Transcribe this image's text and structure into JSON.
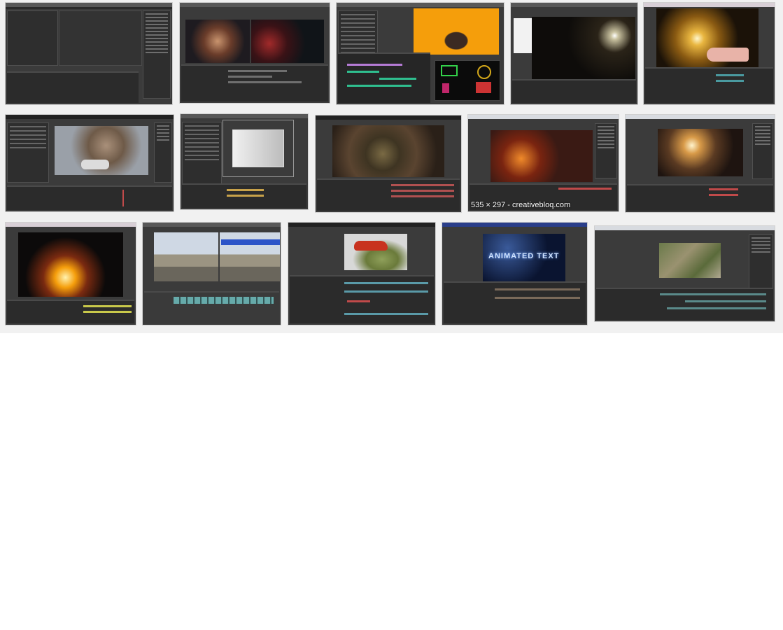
{
  "page": {
    "background": "#ffffff",
    "results_background": "#f1f1f1"
  },
  "results": [
    {
      "id": 1,
      "subject": "empty-ae-workspace"
    },
    {
      "id": 2,
      "subject": "ironman-face-hud"
    },
    {
      "id": 3,
      "subject": "man-on-orange-background"
    },
    {
      "id": 4,
      "subject": "night-city-lens-flare"
    },
    {
      "id": 5,
      "subject": "golden-portal-hand"
    },
    {
      "id": 6,
      "subject": "car-explosion-desert"
    },
    {
      "id": 7,
      "subject": "3d-room-camera"
    },
    {
      "id": 8,
      "subject": "grenade-hand"
    },
    {
      "id": 9,
      "subject": "burning-face",
      "caption": "535 × 297 - creativebloq.com"
    },
    {
      "id": 10,
      "subject": "window-light-rays"
    },
    {
      "id": 11,
      "subject": "fire-in-hands"
    },
    {
      "id": 12,
      "subject": "soldier-walking-split"
    },
    {
      "id": 13,
      "subject": "red-car-on-melon"
    },
    {
      "id": 14,
      "subject": "space-text",
      "overlay_text": "ANIMATED TEXT"
    },
    {
      "id": 15,
      "subject": "aerial-map"
    }
  ]
}
